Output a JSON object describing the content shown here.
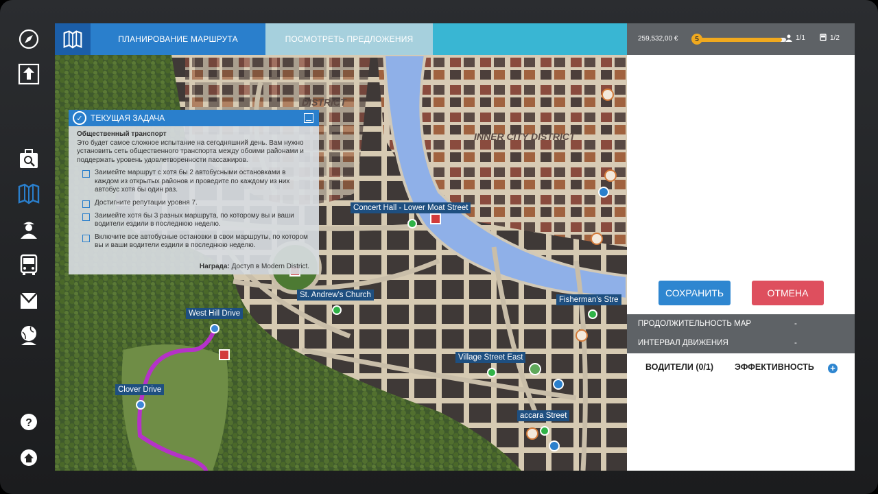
{
  "tabs": {
    "route_planning": "ПЛАНИРОВАНИЕ МАРШРУТА",
    "view_offers": "ПОСМОТРЕТЬ ПРЕДЛОЖЕНИЯ"
  },
  "stats": {
    "money": "259,532,00 €",
    "level": "5",
    "level_progress": 0.95,
    "drivers": "1/1",
    "buses": "1/2"
  },
  "task": {
    "title": "ТЕКУЩАЯ ЗАДАЧА",
    "subtitle": "Общественный транспорт",
    "description": "Это будет самое сложное испытание на сегодняшний день. Вам нужно установить сеть общественного транспорта между обоими районами и поддержать уровень удовлетворенности пассажиров.",
    "objectives": [
      "Заимейте маршрут с хотя бы 2 автобусными остановками в каждом из открытых районов и проведите по каждому из них автобус хотя бы один раз.",
      "Достигните репутации уровня 7.",
      "Заимейте хотя бы 3 разных маршрута, по которому вы и ваши водители ездили в последнюю неделю.",
      "Включите все автобусные остановки в свои маршруты, по котором вы и ваши водители ездили в последнюю неделю."
    ],
    "reward_label": "Награда:",
    "reward_value": "Доступ в Modern District."
  },
  "map": {
    "districts": [
      "INNER CITY DISTRICT",
      "DISTRICT"
    ],
    "stops": [
      {
        "name": "Concert Hall - Lower Moat Street",
        "type": "green"
      },
      {
        "name": "St. Andrew's Church",
        "type": "green"
      },
      {
        "name": "West Hill Drive",
        "type": "blue"
      },
      {
        "name": "Clover Drive",
        "type": "blue"
      },
      {
        "name": "Fisherman's Stre",
        "type": "green"
      },
      {
        "name": "Village Street East",
        "type": "green"
      },
      {
        "name": "accara Street",
        "type": "green"
      }
    ]
  },
  "panel": {
    "save": "СОХРАНИТЬ",
    "cancel": "ОТМЕНА",
    "duration_label": "ПРОДОЛЖИТЕЛЬНОСТЬ МАР",
    "duration_value": "-",
    "interval_label": "ИНТЕРВАЛ ДВИЖЕНИЯ",
    "interval_value": "-",
    "drivers_tab": "ВОДИТЕЛИ (0/1)",
    "efficiency_tab": "ЭФФЕКТИВНОСТЬ",
    "add": "+"
  },
  "colors": {
    "tab_active": "#2a7fcc",
    "route": "#b532c8",
    "water": "#8fb0e8",
    "save": "#2e86d0",
    "cancel": "#de4f5e"
  },
  "icons": [
    "compass-icon",
    "exit-icon",
    "search-briefcase-icon",
    "map-icon",
    "driver-icon",
    "bus-icon",
    "mail-icon",
    "globe-person-icon",
    "help-icon",
    "home-icon"
  ]
}
